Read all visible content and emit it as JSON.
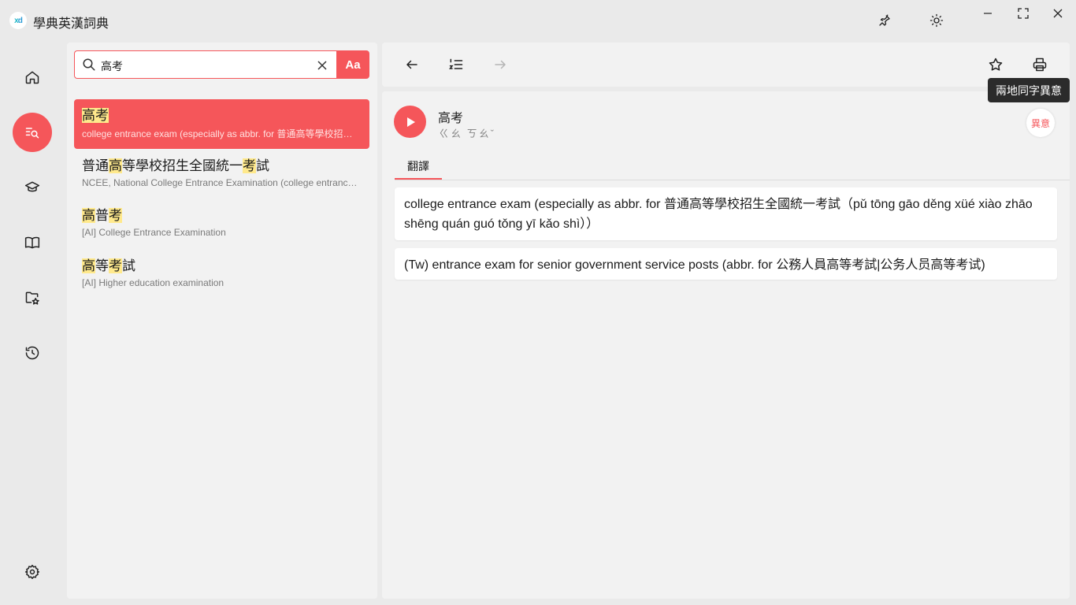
{
  "app": {
    "logo_text_x": "x",
    "logo_text_d": "d",
    "title": "學典英漢詞典"
  },
  "titlebar": {
    "icons": [
      "pin-icon",
      "theme-icon",
      "minimize-icon",
      "maximize-icon",
      "close-icon"
    ]
  },
  "nav": {
    "items": [
      {
        "name": "home",
        "icon": "home-icon",
        "active": false
      },
      {
        "name": "search",
        "icon": "search-list-icon",
        "active": true
      },
      {
        "name": "learn",
        "icon": "graduation-cap-icon",
        "active": false
      },
      {
        "name": "dictionary",
        "icon": "book-icon",
        "active": false
      },
      {
        "name": "favorites",
        "icon": "folder-star-icon",
        "active": false
      },
      {
        "name": "history",
        "icon": "history-icon",
        "active": false
      }
    ],
    "settings_icon": "gear-icon"
  },
  "search": {
    "value": "高考",
    "case_button_label": "Aa"
  },
  "results": [
    {
      "word_parts": [
        {
          "t": "高考",
          "hl": true
        }
      ],
      "definition": "college entrance exam (especially as abbr. for 普通高等學校招生全國統一考試（pǔ tōng gāo děng xüé xiào zhāo shēng quán guó tǒng yī kǎo shì））",
      "selected": true
    },
    {
      "word_parts": [
        {
          "t": "普通",
          "hl": false
        },
        {
          "t": "高",
          "hl": true
        },
        {
          "t": "等學校招生全國統一",
          "hl": false
        },
        {
          "t": "考",
          "hl": true
        },
        {
          "t": "試",
          "hl": false
        }
      ],
      "definition": "NCEE, National College Entrance Examination (college entrance exam)",
      "selected": false
    },
    {
      "word_parts": [
        {
          "t": "高",
          "hl": true
        },
        {
          "t": "普",
          "hl": false
        },
        {
          "t": "考",
          "hl": true
        }
      ],
      "definition": "[AI] College Entrance Examination",
      "selected": false
    },
    {
      "word_parts": [
        {
          "t": "高",
          "hl": true
        },
        {
          "t": "等",
          "hl": false
        },
        {
          "t": "考",
          "hl": true
        },
        {
          "t": "試",
          "hl": false
        }
      ],
      "definition": "[AI] Higher education examination",
      "selected": false
    }
  ],
  "toolbar": {
    "icons": [
      "back-arrow-icon",
      "list-numbered-icon",
      "forward-arrow-icon",
      "star-icon",
      "print-icon"
    ],
    "tooltip": "兩地同字異意"
  },
  "entry": {
    "word": "高考",
    "zhuyin": "ㄍㄠ ㄎㄠˇ",
    "badge": "異意",
    "tab": "翻譯",
    "definitions": [
      "college entrance exam (especially as abbr. for 普通高等學校招生全國統一考試（pǔ tōng gāo děng xüé xiào zhāo shēng quán guó tǒng yī kǎo shì））",
      "(Tw) entrance exam for senior government service posts (abbr. for 公務人員高等考試|公务人员高等考试)"
    ]
  },
  "colors": {
    "accent": "#f5565a",
    "highlight": "#ffe98c",
    "panel": "#f2f2f2",
    "background": "#eaeaea"
  }
}
